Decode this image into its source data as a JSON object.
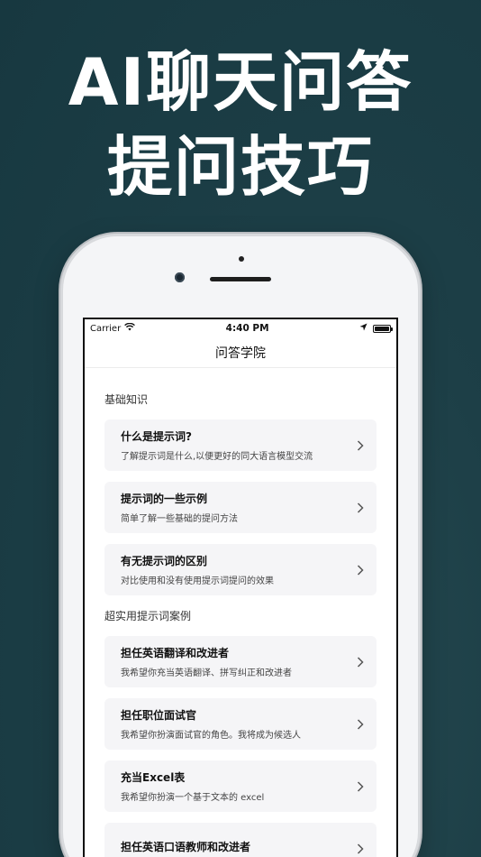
{
  "promo": {
    "line1": "AI聊天问答",
    "line2": "提问技巧"
  },
  "status_bar": {
    "carrier": "Carrier",
    "time": "4:40 PM"
  },
  "nav": {
    "title": "问答学院"
  },
  "sections": [
    {
      "title": "基础知识",
      "items": [
        {
          "title": "什么是提示词?",
          "desc": "了解提示词是什么,以便更好的同大语言模型交流"
        },
        {
          "title": "提示词的一些示例",
          "desc": "简单了解一些基础的提问方法"
        },
        {
          "title": "有无提示词的区别",
          "desc": "对比使用和没有使用提示词提问的效果"
        }
      ]
    },
    {
      "title": "超实用提示词案例",
      "items": [
        {
          "title": "担任英语翻译和改进者",
          "desc": "我希望你充当英语翻译、拼写纠正和改进者"
        },
        {
          "title": "担任职位面试官",
          "desc": "我希望你扮演面试官的角色。我将成为候选人"
        },
        {
          "title": "充当Excel表",
          "desc": "我希望你扮演一个基于文本的 excel"
        },
        {
          "title": "担任英语口语教师和改进者",
          "desc": ""
        }
      ]
    }
  ],
  "tabbar": {
    "icons": [
      "chat-icon",
      "home-icon",
      "lightbulb-icon"
    ]
  },
  "colors": {
    "background": "#1d3f47",
    "accent": "#1d3f47",
    "card": "#f5f5f7"
  }
}
